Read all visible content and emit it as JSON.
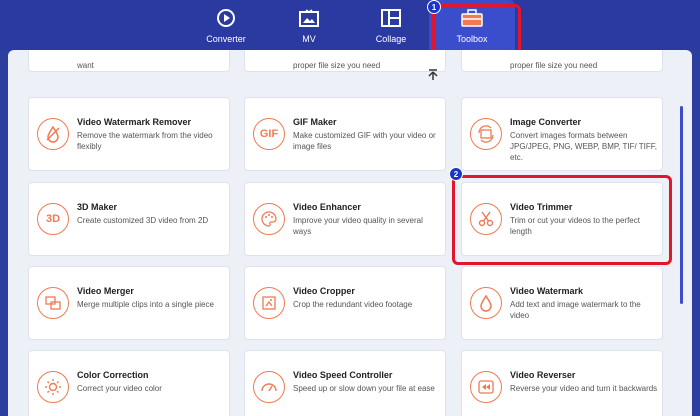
{
  "nav": {
    "tabs": [
      {
        "label": "Converter",
        "icon": "converter-icon"
      },
      {
        "label": "MV",
        "icon": "mv-icon"
      },
      {
        "label": "Collage",
        "icon": "collage-icon"
      },
      {
        "label": "Toolbox",
        "icon": "toolbox-icon",
        "active": true
      }
    ]
  },
  "badges": {
    "first": "1",
    "second": "2"
  },
  "partial": {
    "col1_desc": "want",
    "col2_desc": "proper file size you need",
    "col3_desc": "proper file size you need"
  },
  "tools": [
    {
      "title": "Video Watermark Remover",
      "desc": "Remove the watermark from the video flexibly",
      "icon": "watermark-remover-icon"
    },
    {
      "title": "GIF Maker",
      "desc": "Make customized GIF with your video or image files",
      "icon": "gif-icon",
      "icon_text": "GIF"
    },
    {
      "title": "Image Converter",
      "desc": "Convert images formats between JPG/JPEG, PNG, WEBP, BMP, TIF/ TIFF, etc.",
      "icon": "image-converter-icon"
    },
    {
      "title": "3D Maker",
      "desc": "Create customized 3D video from 2D",
      "icon": "3d-icon",
      "icon_text": "3D"
    },
    {
      "title": "Video Enhancer",
      "desc": "Improve your video quality in several ways",
      "icon": "palette-icon"
    },
    {
      "title": "Video Trimmer",
      "desc": "Trim or cut your videos to the perfect length",
      "icon": "scissors-icon"
    },
    {
      "title": "Video Merger",
      "desc": "Merge multiple clips into a single piece",
      "icon": "merge-icon"
    },
    {
      "title": "Video Cropper",
      "desc": "Crop the redundant video footage",
      "icon": "crop-icon"
    },
    {
      "title": "Video Watermark",
      "desc": "Add text and image watermark to the video",
      "icon": "droplet-icon"
    },
    {
      "title": "Color Correction",
      "desc": "Correct your video color",
      "icon": "sun-icon"
    },
    {
      "title": "Video Speed Controller",
      "desc": "Speed up or slow down your file at ease",
      "icon": "speedometer-icon"
    },
    {
      "title": "Video Reverser",
      "desc": "Reverse your video and turn it backwards",
      "icon": "rewind-icon"
    }
  ],
  "colors": {
    "accent": "#f07a52",
    "highlight": "#e0162b",
    "nav_bg": "#2b3aa0"
  }
}
